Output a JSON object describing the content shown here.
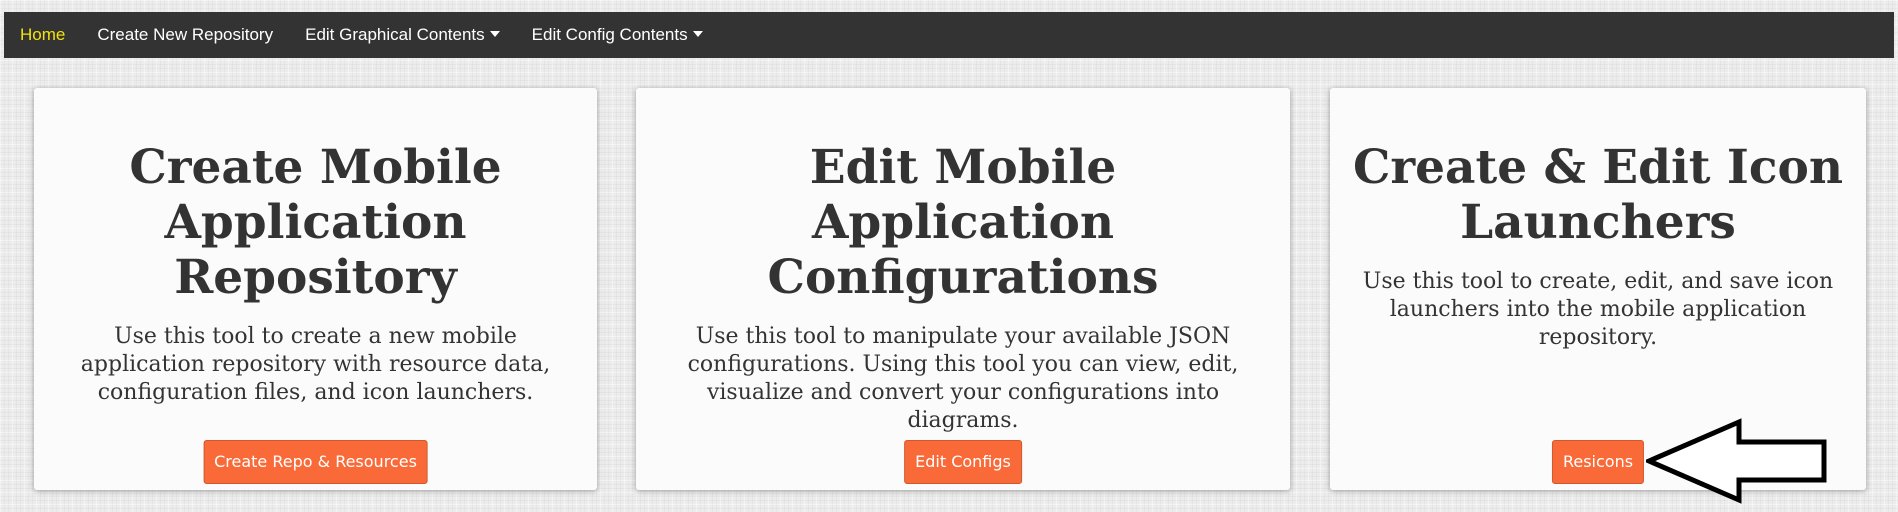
{
  "nav": {
    "home": "Home",
    "create_repo": "Create New Repository",
    "edit_graphical": "Edit Graphical Contents",
    "edit_config": "Edit Config Contents"
  },
  "cards": [
    {
      "title": "Create Mobile Application Repository",
      "description": "Use this tool to create a new mobile application repository with resource data, configuration files, and icon launchers.",
      "button": "Create Repo & Resources"
    },
    {
      "title": "Edit Mobile Application Configurations",
      "description": "Use this tool to manipulate your available JSON configurations. Using this tool you can view, edit, visualize and convert your configurations into diagrams.",
      "button": "Edit Configs"
    },
    {
      "title": "Create & Edit Icon Launchers",
      "description": "Use this tool to create, edit, and save icon launchers into the mobile application repository.",
      "button": "Resicons"
    }
  ],
  "colors": {
    "navbar": "#333333",
    "active_nav": "#f1e20c",
    "button": "#f96a38",
    "text": "#333333"
  },
  "icons": {
    "dropdown": "caret-down-icon",
    "pointer": "left-arrow-icon"
  }
}
